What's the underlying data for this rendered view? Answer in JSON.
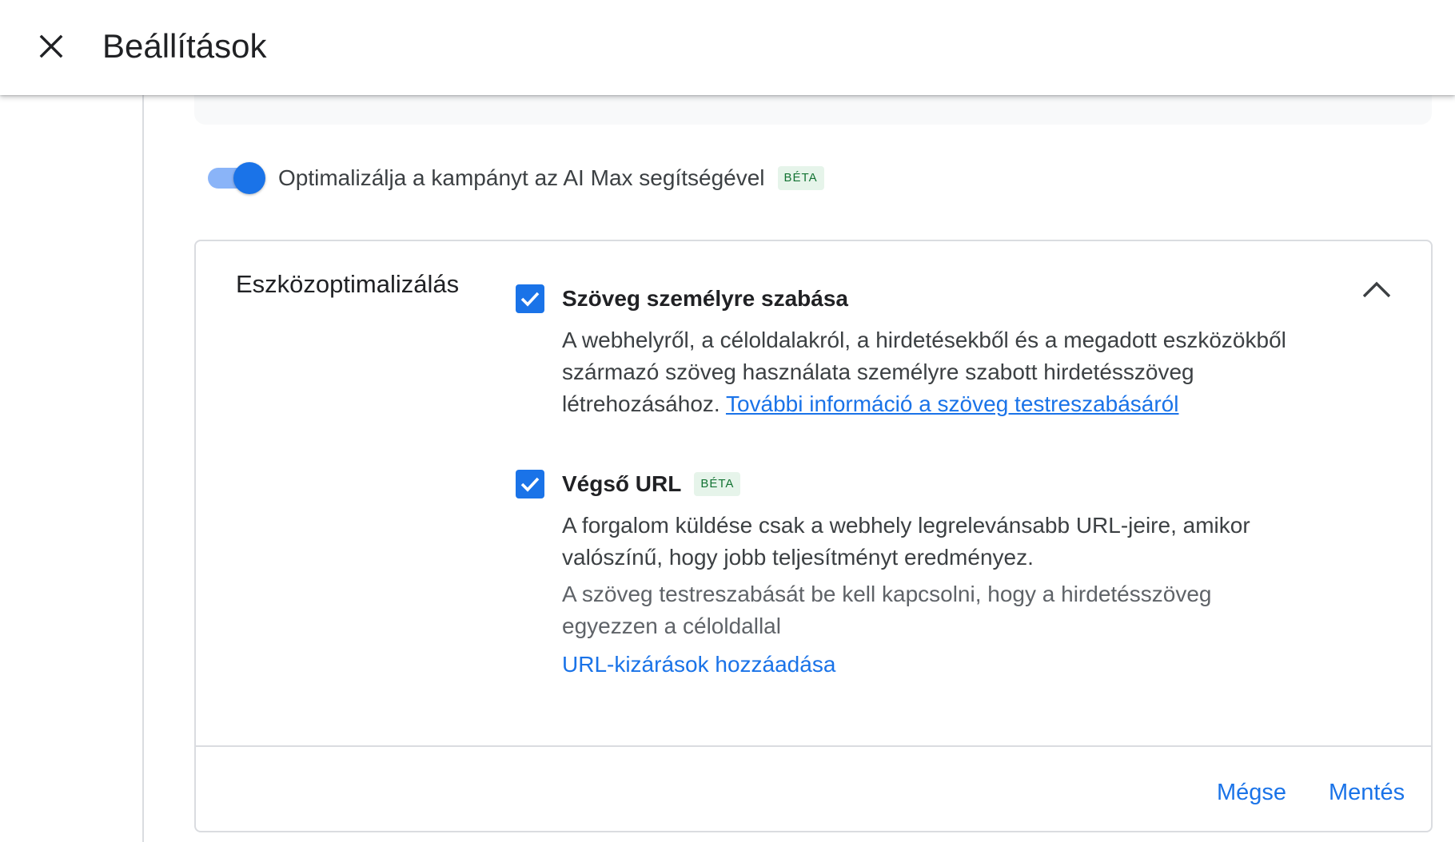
{
  "header": {
    "title": "Beállítások",
    "close_icon": "close-icon"
  },
  "ai_max": {
    "toggle_state": "on",
    "label": "Optimalizálja a kampányt az AI Max segítségével",
    "badge": "BÉTA"
  },
  "asset_optimization": {
    "title": "Eszközoptimalizálás",
    "collapse_icon": "chevron-up-icon",
    "text_customization": {
      "checked": true,
      "title": "Szöveg személyre szabása",
      "description_line1": "A webhelyről, a céloldalakról, a hirdetésekből és a megadott eszközökből",
      "description_line2": "származó szöveg használata személyre szabott hirdetésszöveg",
      "description_line3": "létrehozásához.",
      "learn_more_link": "További információ a szöveg testreszabásáról"
    },
    "final_url": {
      "checked": true,
      "title": "Végső URL",
      "badge": "BÉTA",
      "description_line1": "A forgalom küldése csak a webhely legrelevánsabb URL-jeire, amikor",
      "description_line2": "valószínű, hogy jobb teljesítményt eredményez.",
      "note_line1": "A szöveg testreszabását be kell kapcsolni, hogy a hirdetésszöveg",
      "note_line2": "egyezzen a céloldallal",
      "add_exclusions_link": "URL-kizárások hozzáadása"
    }
  },
  "footer": {
    "cancel_label": "Mégse",
    "save_label": "Mentés"
  },
  "colors": {
    "accent": "#1a73e8",
    "toggle_track": "#8ab4f8",
    "beta_bg": "#e6f4ea",
    "beta_text": "#137333"
  }
}
